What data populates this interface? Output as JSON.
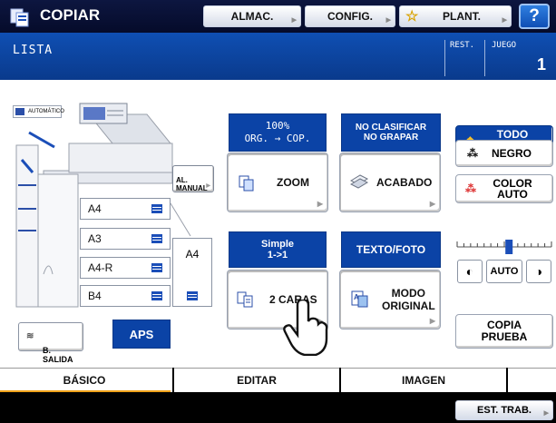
{
  "app": {
    "title": "COPIAR"
  },
  "header_buttons": {
    "store": "ALMAC.",
    "config": "CONFIG.",
    "template": "PLANT.",
    "help": "?"
  },
  "status": {
    "message": "LISTA",
    "remaining_label": "REST.",
    "sets_label": "JUEGO",
    "sets_value": "1"
  },
  "machine": {
    "auto_feeder_label": "AUTOMÁTICO",
    "manual_feed_label": "AL.\nMANUAL",
    "trays": [
      "A4",
      "A3",
      "A4-R",
      "B4"
    ],
    "side_tray": "A4",
    "exit_label": "B.\nSALIDA",
    "aps_label": "APS"
  },
  "functions": {
    "zoom_head": "100%\nORG.  → COP.",
    "zoom_label": "ZOOM",
    "finish_head": "NO CLASIFICAR\nNO GRAPAR",
    "finish_label": "ACABADO",
    "duplex_head": "Simple\n1->1",
    "duplex_label": "2 CARAS",
    "mode_head": "TEXTO/FOTO",
    "mode_label": "MODO\nORIGINAL"
  },
  "color": {
    "full": "TODO\nCOLOR",
    "black": "NEGRO",
    "auto": "COLOR\nAUTO"
  },
  "density": {
    "auto": "AUTO",
    "level": 0.55
  },
  "proof": {
    "label": "COPIA\nPRUEBA"
  },
  "tabs": [
    "BÁSICO",
    "EDITAR",
    "IMAGEN"
  ],
  "footer": {
    "job_status": "EST. TRAB."
  },
  "colors": {
    "header": "#050b2a",
    "status": "#0a3a8c",
    "accent": "#0b43a6",
    "tab_active_edge": "#f0a21a"
  }
}
